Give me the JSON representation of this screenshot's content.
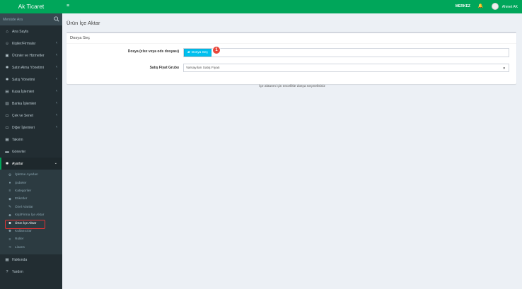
{
  "app": {
    "title": "Ak Ticaret"
  },
  "topbar": {
    "branch": "MERKEZ",
    "user": "Ahmet AK",
    "menu_icon": "hamburger-icon",
    "bell_icon": "bell-icon"
  },
  "search": {
    "placeholder": "Menüde Ara"
  },
  "sidebar": {
    "items": [
      {
        "label": "Ana Sayfa",
        "icon": "dashboard-icon"
      },
      {
        "label": "Kişiler/Firmalar",
        "icon": "users-icon"
      },
      {
        "label": "Ürünler ve Hizmetler",
        "icon": "box-icon"
      },
      {
        "label": "Satın Alma Yönetimi",
        "icon": "gear-icon"
      },
      {
        "label": "Satış Yönetimi",
        "icon": "gear-icon"
      },
      {
        "label": "Kasa İşlemleri",
        "icon": "cash-icon"
      },
      {
        "label": "Banka İşlemleri",
        "icon": "bank-icon"
      },
      {
        "label": "Çek ve Senet",
        "icon": "cheque-icon"
      },
      {
        "label": "Diğer İşlemleri",
        "icon": "bill-icon"
      },
      {
        "label": "Takvim",
        "icon": "calendar-icon"
      },
      {
        "label": "Görevler",
        "icon": "tasks-icon"
      },
      {
        "label": "Ayarlar",
        "icon": "settings-icon"
      }
    ],
    "settings_sub": [
      {
        "label": "İşletme Ayarları",
        "icon": "cogs-icon"
      },
      {
        "label": "Şubeler",
        "icon": "map-marker-icon"
      },
      {
        "label": "Kategoriler",
        "icon": "list-icon"
      },
      {
        "label": "Etiketler",
        "icon": "tag-icon"
      },
      {
        "label": "Özel Alanlar",
        "icon": "wrench-icon"
      },
      {
        "label": "Kişi/Firma İçe Aktar",
        "icon": "user-import-icon"
      },
      {
        "label": "Ürün İçe Aktar",
        "icon": "user-import-icon"
      },
      {
        "label": "Kullanıcılar",
        "icon": "user-icon"
      },
      {
        "label": "Roller",
        "icon": "list-icon"
      },
      {
        "label": "Lisans",
        "icon": "share-icon"
      }
    ],
    "bottom": [
      {
        "label": "Hakkında",
        "icon": "building-icon"
      },
      {
        "label": "Yardım",
        "icon": "question-icon"
      }
    ]
  },
  "page": {
    "title": "Ürün İçe Aktar",
    "box_title": "Dosya Seç",
    "file_label": "Dosya (xlsx veya ods dosyası)",
    "file_button": "Dosya Seç",
    "badge": "1",
    "price_label": "Satış Fiyat Grubu",
    "price_value": "Varsayılan Satış Fiyatı",
    "note": "İçe aktarım için öncelikle dosya seçmelisiniz"
  },
  "colors": {
    "brand": "#00a65a",
    "sidebar": "#222d32",
    "button": "#00c0ef",
    "badge": "#e8473b"
  }
}
